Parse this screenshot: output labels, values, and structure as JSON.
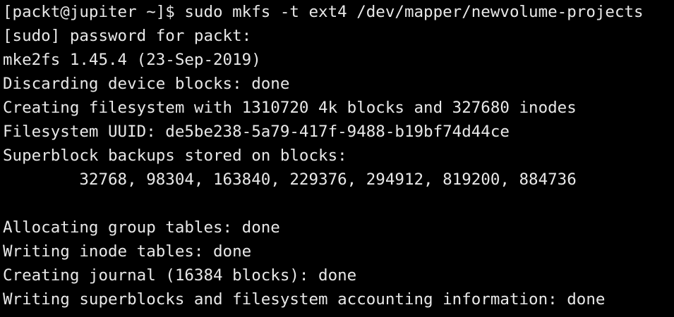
{
  "terminal": {
    "lines": [
      "[packt@jupiter ~]$ sudo mkfs -t ext4 /dev/mapper/newvolume-projects",
      "[sudo] password for packt:",
      "mke2fs 1.45.4 (23-Sep-2019)",
      "Discarding device blocks: done",
      "Creating filesystem with 1310720 4k blocks and 327680 inodes",
      "Filesystem UUID: de5be238-5a79-417f-9488-b19bf74d44ce",
      "Superblock backups stored on blocks:",
      "        32768, 98304, 163840, 229376, 294912, 819200, 884736",
      "",
      "Allocating group tables: done",
      "Writing inode tables: done",
      "Creating journal (16384 blocks): done",
      "Writing superblocks and filesystem accounting information: done"
    ]
  }
}
